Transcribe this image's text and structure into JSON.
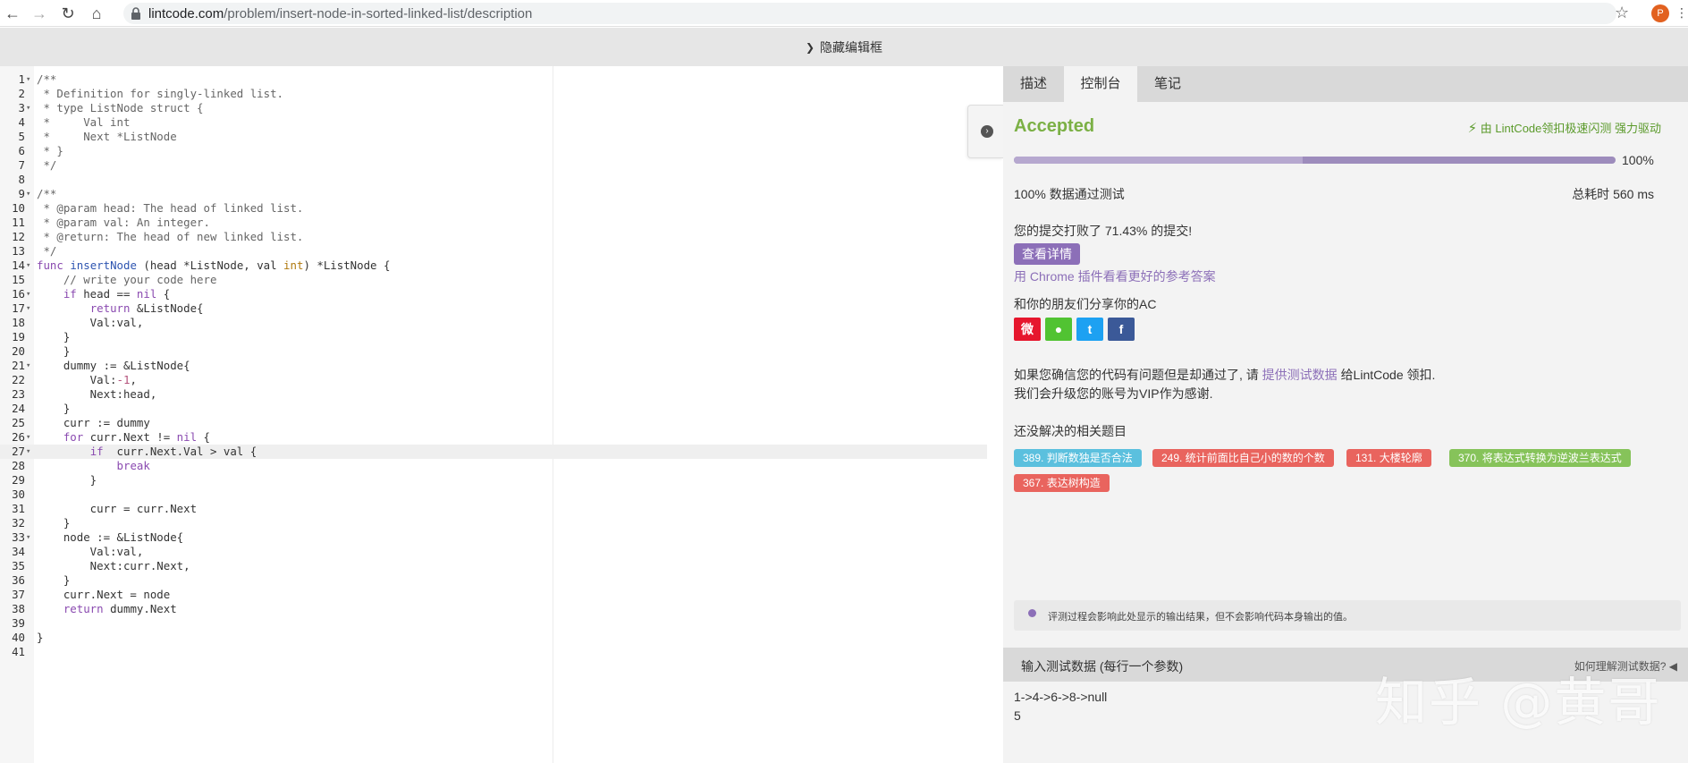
{
  "browser": {
    "url_domain": "lintcode.com",
    "url_path": "/problem/insert-node-in-sorted-linked-list/description",
    "avatar_letter": "P"
  },
  "editor_toggle": {
    "label": "隐藏编辑框"
  },
  "editor": {
    "active_line": 27,
    "lines": [
      {
        "n": "1",
        "fold": true,
        "text": "/**",
        "cls": "c-comment"
      },
      {
        "n": "2",
        "text": " * Definition for singly-linked list.",
        "cls": "c-comment"
      },
      {
        "n": "3",
        "fold": true,
        "text": " * type ListNode struct {",
        "cls": "c-comment"
      },
      {
        "n": "4",
        "text": " *     Val int",
        "cls": "c-comment"
      },
      {
        "n": "5",
        "text": " *     Next *ListNode",
        "cls": "c-comment"
      },
      {
        "n": "6",
        "text": " * }",
        "cls": "c-comment"
      },
      {
        "n": "7",
        "text": " */",
        "cls": "c-comment"
      },
      {
        "n": "8",
        "text": ""
      },
      {
        "n": "9",
        "fold": true,
        "text": "/**",
        "cls": "c-comment"
      },
      {
        "n": "10",
        "text": " * @param head: The head of linked list.",
        "cls": "c-comment"
      },
      {
        "n": "11",
        "text": " * @param val: An integer.",
        "cls": "c-comment"
      },
      {
        "n": "12",
        "text": " * @return: The head of new linked list.",
        "cls": "c-comment"
      },
      {
        "n": "13",
        "text": " */",
        "cls": "c-comment"
      },
      {
        "n": "14",
        "fold": true,
        "text": "func insertNode (head *ListNode, val int) *ListNode {"
      },
      {
        "n": "15",
        "text": "    // write your code here",
        "cls": "c-comment"
      },
      {
        "n": "16",
        "fold": true,
        "text": "    if head == nil {"
      },
      {
        "n": "17",
        "fold": true,
        "text": "        return &ListNode{"
      },
      {
        "n": "18",
        "text": "        Val:val,"
      },
      {
        "n": "19",
        "text": "    }"
      },
      {
        "n": "20",
        "text": "    }"
      },
      {
        "n": "21",
        "fold": true,
        "text": "    dummy := &ListNode{"
      },
      {
        "n": "22",
        "text": "        Val:-1,"
      },
      {
        "n": "23",
        "text": "        Next:head,"
      },
      {
        "n": "24",
        "text": "    }"
      },
      {
        "n": "25",
        "text": "    curr := dummy"
      },
      {
        "n": "26",
        "fold": true,
        "text": "    for curr.Next != nil {"
      },
      {
        "n": "27",
        "fold": true,
        "text": "        if  curr.Next.Val > val {"
      },
      {
        "n": "28",
        "text": "            break"
      },
      {
        "n": "29",
        "text": "        }"
      },
      {
        "n": "30",
        "text": ""
      },
      {
        "n": "31",
        "text": "        curr = curr.Next"
      },
      {
        "n": "32",
        "text": "    }"
      },
      {
        "n": "33",
        "fold": true,
        "text": "    node := &ListNode{"
      },
      {
        "n": "34",
        "text": "        Val:val,"
      },
      {
        "n": "35",
        "text": "        Next:curr.Next,"
      },
      {
        "n": "36",
        "text": "    }"
      },
      {
        "n": "37",
        "text": "    curr.Next = node"
      },
      {
        "n": "38",
        "text": "    return dummy.Next"
      },
      {
        "n": "39",
        "text": ""
      },
      {
        "n": "40",
        "text": "}"
      },
      {
        "n": "41",
        "text": ""
      }
    ]
  },
  "panel": {
    "tabs": [
      "描述",
      "控制台",
      "笔记"
    ],
    "active_tab": "控制台",
    "status": "Accepted",
    "powered_by": "由 LintCode领扣极速闪测 强力驱动",
    "progress_fraction": 1.0,
    "progress_label": "100%",
    "passed_text": "100% 数据通过测试",
    "time_text": "总耗时 560 ms",
    "beat_text": "您的提交打败了 71.43% 的提交!",
    "detail_button": "查看详情",
    "chrome_link": "用 Chrome 插件看看更好的参考答案",
    "share_text": "和你的朋友们分享你的AC",
    "share_icons": [
      "weibo-icon",
      "wechat-icon",
      "twitter-icon",
      "facebook-icon"
    ],
    "report_prefix": "如果您确信您的代码有问题但是却通过了, 请",
    "report_link": "提供测试数据",
    "report_suffix": "给LintCode 领扣.",
    "report_line2": "我们会升级您的账号为VIP作为感谢.",
    "related_title": "还没解决的相关题目",
    "related": [
      {
        "label": "389. 判断数独是否合法",
        "color": "#5bc0de"
      },
      {
        "label": "249. 统计前面比自己小的数的个数",
        "color": "#e9645e"
      },
      {
        "label": "131. 大楼轮廓",
        "color": "#e9645e"
      },
      {
        "label": "370. 将表达式转换为逆波兰表达式",
        "color": "#86c35a"
      },
      {
        "label": "367. 表达树构造",
        "color": "#e9645e"
      }
    ],
    "note": "评测过程会影响此处显示的输出结果，但不会影响代码本身输出的值。",
    "input_title": "输入测试数据 (每行一个参数)",
    "input_help": "如何理解测试数据?",
    "input_values": [
      "1->4->6->8->null",
      "5"
    ]
  },
  "watermark": "知乎 @黄哥"
}
